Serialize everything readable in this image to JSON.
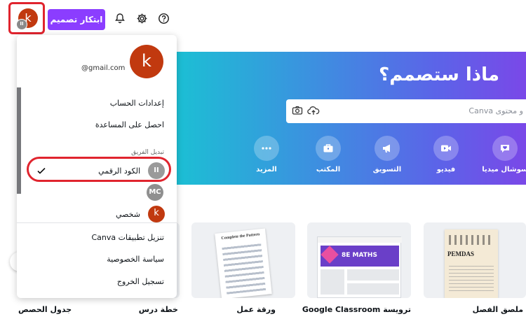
{
  "topbar": {
    "avatar_letter": "k",
    "avatar_badge": "II",
    "create_label": "ابتكار تصميم",
    "icons": [
      "help-icon",
      "gear-icon",
      "bell-icon"
    ]
  },
  "hero": {
    "title": "ماذا ستصمم؟",
    "search_placeholder": "و محتوى Canva",
    "categories": [
      {
        "label": "سوشال ميديا",
        "icon": "heart-chat-icon"
      },
      {
        "label": "فيديو",
        "icon": "video-icon"
      },
      {
        "label": "التسويق",
        "icon": "megaphone-icon"
      },
      {
        "label": "المكتب",
        "icon": "briefcase-icon"
      },
      {
        "label": "المزيد",
        "icon": "more-icon"
      }
    ]
  },
  "cards": [
    {
      "label": "ملصق الفصل",
      "thumb_text": "PEMDAS"
    },
    {
      "label": "ترويسة Google Classroom",
      "thumb_text": "8E MATHS"
    },
    {
      "label": "ورقة عمل",
      "thumb_text": "Complete the Pattern"
    },
    {
      "label": "خطة درس"
    },
    {
      "label": "جدول الحصص"
    }
  ],
  "menu": {
    "avatar_letter": "k",
    "email": "@gmail.com",
    "account_settings": "إعدادات الحساب",
    "get_help": "احصل على المساعدة",
    "switch_team": "تبديل الفريق",
    "teams": [
      {
        "name": "الكود الرقمي",
        "initials": "II",
        "color": "#9a9a9a",
        "selected": true
      },
      {
        "name": "",
        "initials": "MC",
        "color": "#8f8f8f",
        "selected": false
      },
      {
        "name": "شخصي",
        "initials": "k",
        "color": "#c1390f",
        "selected": false
      }
    ],
    "download_apps": "تنزيل تطبيقات Canva",
    "privacy": "سياسة الخصوصية",
    "logout": "تسجيل الخروج"
  }
}
